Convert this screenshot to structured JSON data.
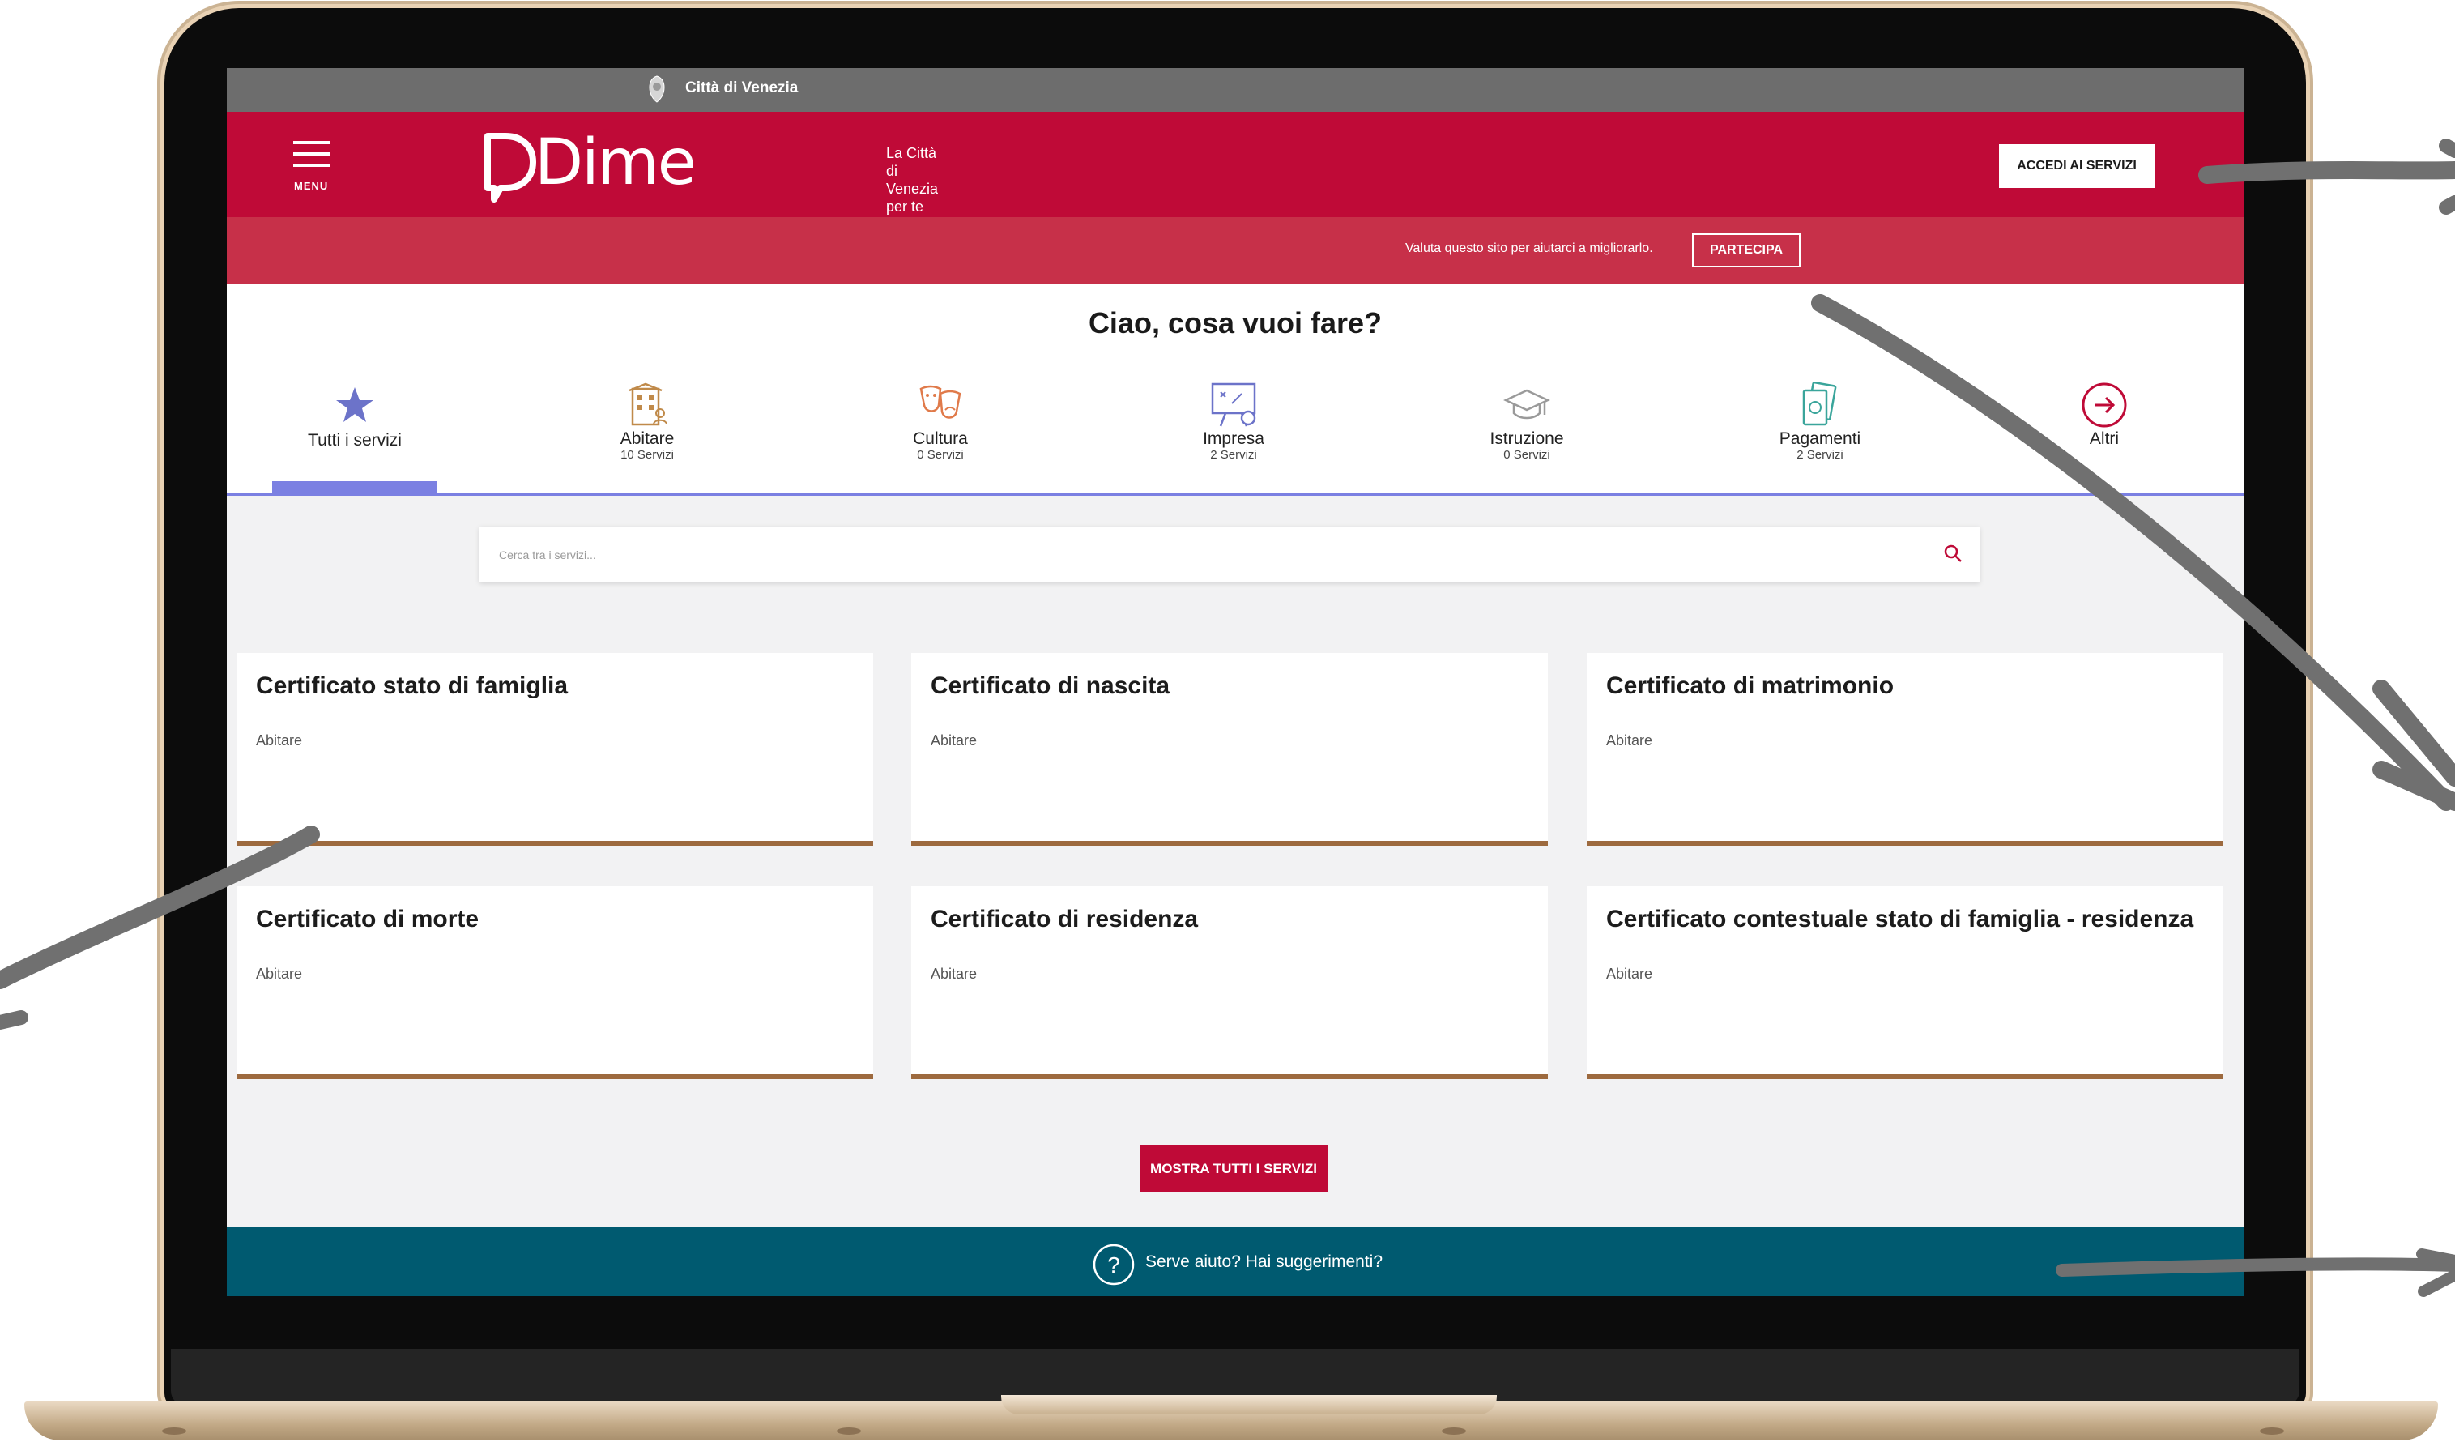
{
  "topbar": {
    "city_name": "Città di Venezia"
  },
  "header": {
    "menu_label": "MENU",
    "logo_word": "Dime",
    "logo_tagline": [
      "La Città",
      "di Venezia",
      "per te"
    ],
    "login_button": "ACCEDI AI SERVIZI"
  },
  "feedback": {
    "message": "Valuta questo sito per aiutarci a migliorarlo.",
    "button": "PARTECIPA"
  },
  "main": {
    "greeting": "Ciao, cosa vuoi fare?",
    "categories": [
      {
        "label": "Tutti i servizi",
        "count": "",
        "icon": "star-icon",
        "active": true
      },
      {
        "label": "Abitare",
        "count": "10 Servizi",
        "icon": "building-icon"
      },
      {
        "label": "Cultura",
        "count": "0 Servizi",
        "icon": "theater-masks-icon"
      },
      {
        "label": "Impresa",
        "count": "2 Servizi",
        "icon": "strategy-board-icon"
      },
      {
        "label": "Istruzione",
        "count": "0 Servizi",
        "icon": "graduation-cap-icon"
      },
      {
        "label": "Pagamenti",
        "count": "2 Servizi",
        "icon": "banknotes-icon"
      },
      {
        "label": "Altri",
        "count": "",
        "icon": "arrow-right-circle-icon"
      }
    ],
    "search_placeholder": "Cerca tra i servizi...",
    "services": [
      {
        "title": "Certificato stato di famiglia",
        "category": "Abitare"
      },
      {
        "title": "Certificato di nascita",
        "category": "Abitare"
      },
      {
        "title": "Certificato di matrimonio",
        "category": "Abitare"
      },
      {
        "title": "Certificato di morte",
        "category": "Abitare"
      },
      {
        "title": "Certificato di residenza",
        "category": "Abitare"
      },
      {
        "title": "Certificato contestuale stato di famiglia - residenza",
        "category": "Abitare"
      }
    ],
    "show_all_button": "MOSTRA TUTTI I SERVIZI"
  },
  "help": {
    "text": "Serve aiuto? Hai suggerimenti?"
  },
  "colors": {
    "brand_red": "#bf0a37",
    "feedback_red": "#c73049",
    "accent_blue": "#7b80e2",
    "card_border": "#9d6a3e",
    "help_bar": "#005a70",
    "topbar_gray": "#6d6d6d"
  }
}
